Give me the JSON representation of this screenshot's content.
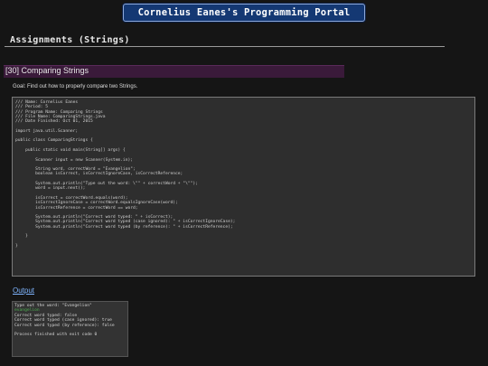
{
  "header": {
    "portal_title": "Cornelius Eanes's Programming Portal"
  },
  "section": {
    "heading": "Assignments (Strings)"
  },
  "assignment": {
    "title": "[30] Comparing Strings",
    "goal": "Goal: Find out how to properly compare two Strings."
  },
  "code": {
    "lines": [
      "/// Name: Cornelius Eanes",
      "/// Period: 5",
      "/// Program Name: Comparing Strings",
      "/// File Name: ComparingStrings.java",
      "/// Date Finished: Oct 01, 2015",
      "",
      "import java.util.Scanner;",
      "",
      "public class ComparingStrings {",
      "",
      "    public static void main(String[] args) {",
      "",
      "        Scanner input = new Scanner(System.in);",
      "",
      "        String word, correctWord = \"Evangelion\";",
      "        boolean isCorrect, isCorrectIgnoreCase, isCorrectReference;",
      "",
      "        System.out.println(\"Type out the word: \\\"\" + correctWord + \"\\\"\");",
      "        word = input.next();",
      "",
      "        isCorrect = correctWord.equals(word);",
      "        isCorrectIgnoreCase = correctWord.equalsIgnoreCase(word);",
      "        isCorrectReference = correctWord == word;",
      "",
      "        System.out.println(\"Correct word typed: \" + isCorrect);",
      "        System.out.println(\"Correct word typed (case ignored): \" + isCorrectIgnoreCase);",
      "        System.out.println(\"Correct word typed (by reference): \" + isCorrectReference);",
      "",
      "    }",
      "",
      "}"
    ]
  },
  "output": {
    "link_label": "Output",
    "lines": [
      {
        "text": "Type out the word: \"Evangelion\"",
        "kind": "normal"
      },
      {
        "text": "evangelion",
        "kind": "input"
      },
      {
        "text": "Correct word typed: false",
        "kind": "normal"
      },
      {
        "text": "Correct word typed (case ignored): true",
        "kind": "normal"
      },
      {
        "text": "Correct word typed (by reference): false",
        "kind": "normal"
      },
      {
        "text": "",
        "kind": "normal"
      },
      {
        "text": "Process finished with exit code 0",
        "kind": "normal"
      }
    ]
  },
  "colors": {
    "background": "#151515",
    "header_bg": "#143873",
    "assignment_bar": "#3a1a3a",
    "link": "#7fb5ff",
    "input_echo": "#4caf50"
  }
}
